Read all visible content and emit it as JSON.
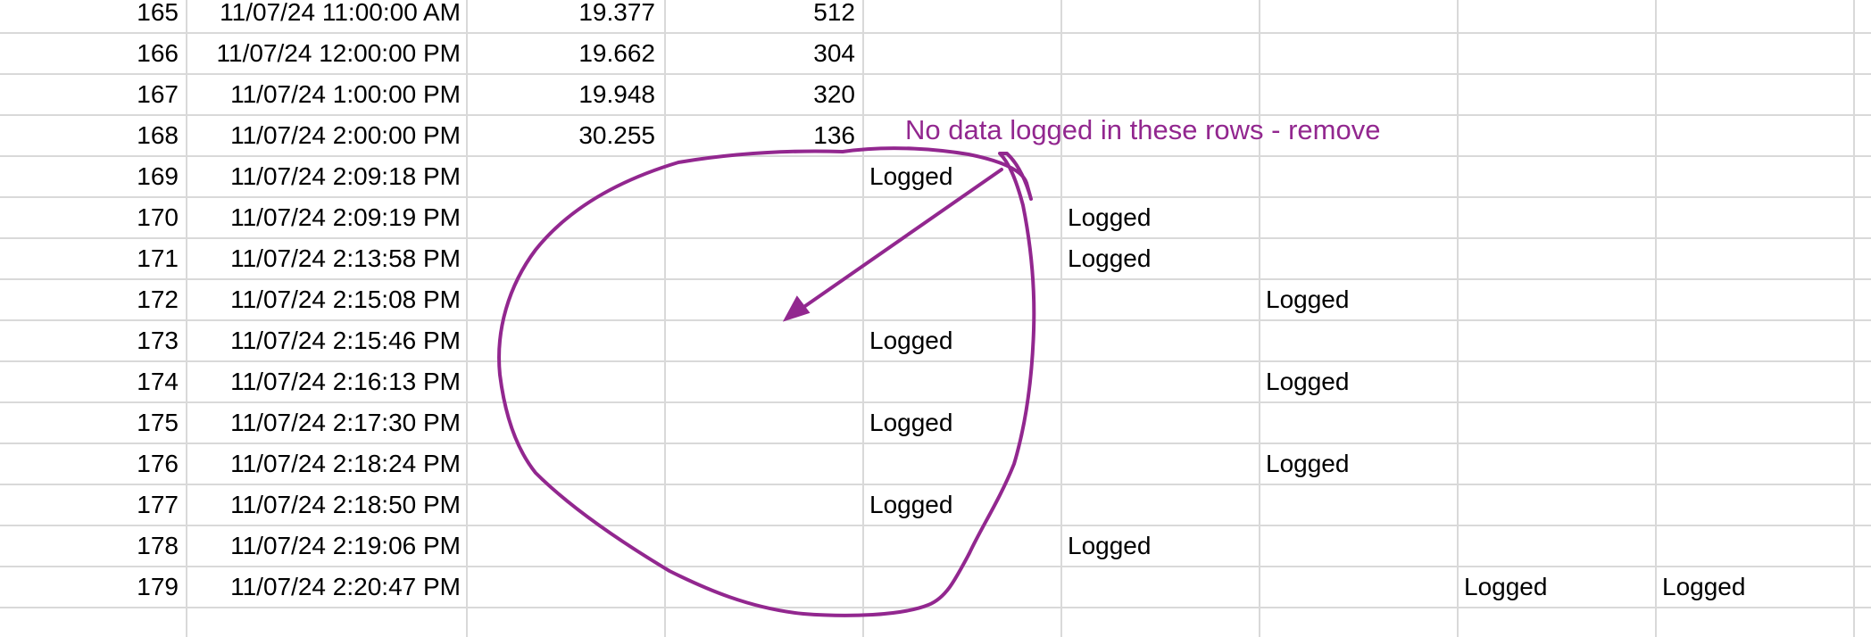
{
  "annotation": {
    "text": "No data logged in these rows - remove",
    "color": "#92278f"
  },
  "rows": [
    {
      "num": "165",
      "time": "11/07/24 11:00:00 AM",
      "value": "19.377",
      "count": "512",
      "logged": []
    },
    {
      "num": "166",
      "time": "11/07/24 12:00:00 PM",
      "value": "19.662",
      "count": "304",
      "logged": []
    },
    {
      "num": "167",
      "time": "11/07/24 1:00:00 PM",
      "value": "19.948",
      "count": "320",
      "logged": []
    },
    {
      "num": "168",
      "time": "11/07/24 2:00:00 PM",
      "value": "30.255",
      "count": "136",
      "logged": []
    },
    {
      "num": "169",
      "time": "11/07/24 2:09:18 PM",
      "value": "",
      "count": "",
      "logged": [
        {
          "col": 0,
          "text": "Logged"
        }
      ]
    },
    {
      "num": "170",
      "time": "11/07/24 2:09:19 PM",
      "value": "",
      "count": "",
      "logged": [
        {
          "col": 1,
          "text": "Logged"
        }
      ]
    },
    {
      "num": "171",
      "time": "11/07/24 2:13:58 PM",
      "value": "",
      "count": "",
      "logged": [
        {
          "col": 1,
          "text": "Logged"
        }
      ]
    },
    {
      "num": "172",
      "time": "11/07/24 2:15:08 PM",
      "value": "",
      "count": "",
      "logged": [
        {
          "col": 2,
          "text": "Logged"
        }
      ]
    },
    {
      "num": "173",
      "time": "11/07/24 2:15:46 PM",
      "value": "",
      "count": "",
      "logged": [
        {
          "col": 0,
          "text": "Logged"
        }
      ]
    },
    {
      "num": "174",
      "time": "11/07/24 2:16:13 PM",
      "value": "",
      "count": "",
      "logged": [
        {
          "col": 2,
          "text": "Logged"
        }
      ]
    },
    {
      "num": "175",
      "time": "11/07/24 2:17:30 PM",
      "value": "",
      "count": "",
      "logged": [
        {
          "col": 0,
          "text": "Logged"
        }
      ]
    },
    {
      "num": "176",
      "time": "11/07/24 2:18:24 PM",
      "value": "",
      "count": "",
      "logged": [
        {
          "col": 2,
          "text": "Logged"
        }
      ]
    },
    {
      "num": "177",
      "time": "11/07/24 2:18:50 PM",
      "value": "",
      "count": "",
      "logged": [
        {
          "col": 0,
          "text": "Logged"
        }
      ]
    },
    {
      "num": "178",
      "time": "11/07/24 2:19:06 PM",
      "value": "",
      "count": "",
      "logged": [
        {
          "col": 1,
          "text": "Logged"
        }
      ]
    },
    {
      "num": "179",
      "time": "11/07/24 2:20:47 PM",
      "value": "",
      "count": "",
      "logged": [
        {
          "col": 3,
          "text": "Logged"
        },
        {
          "col": 4,
          "text": "Logged"
        }
      ]
    }
  ]
}
